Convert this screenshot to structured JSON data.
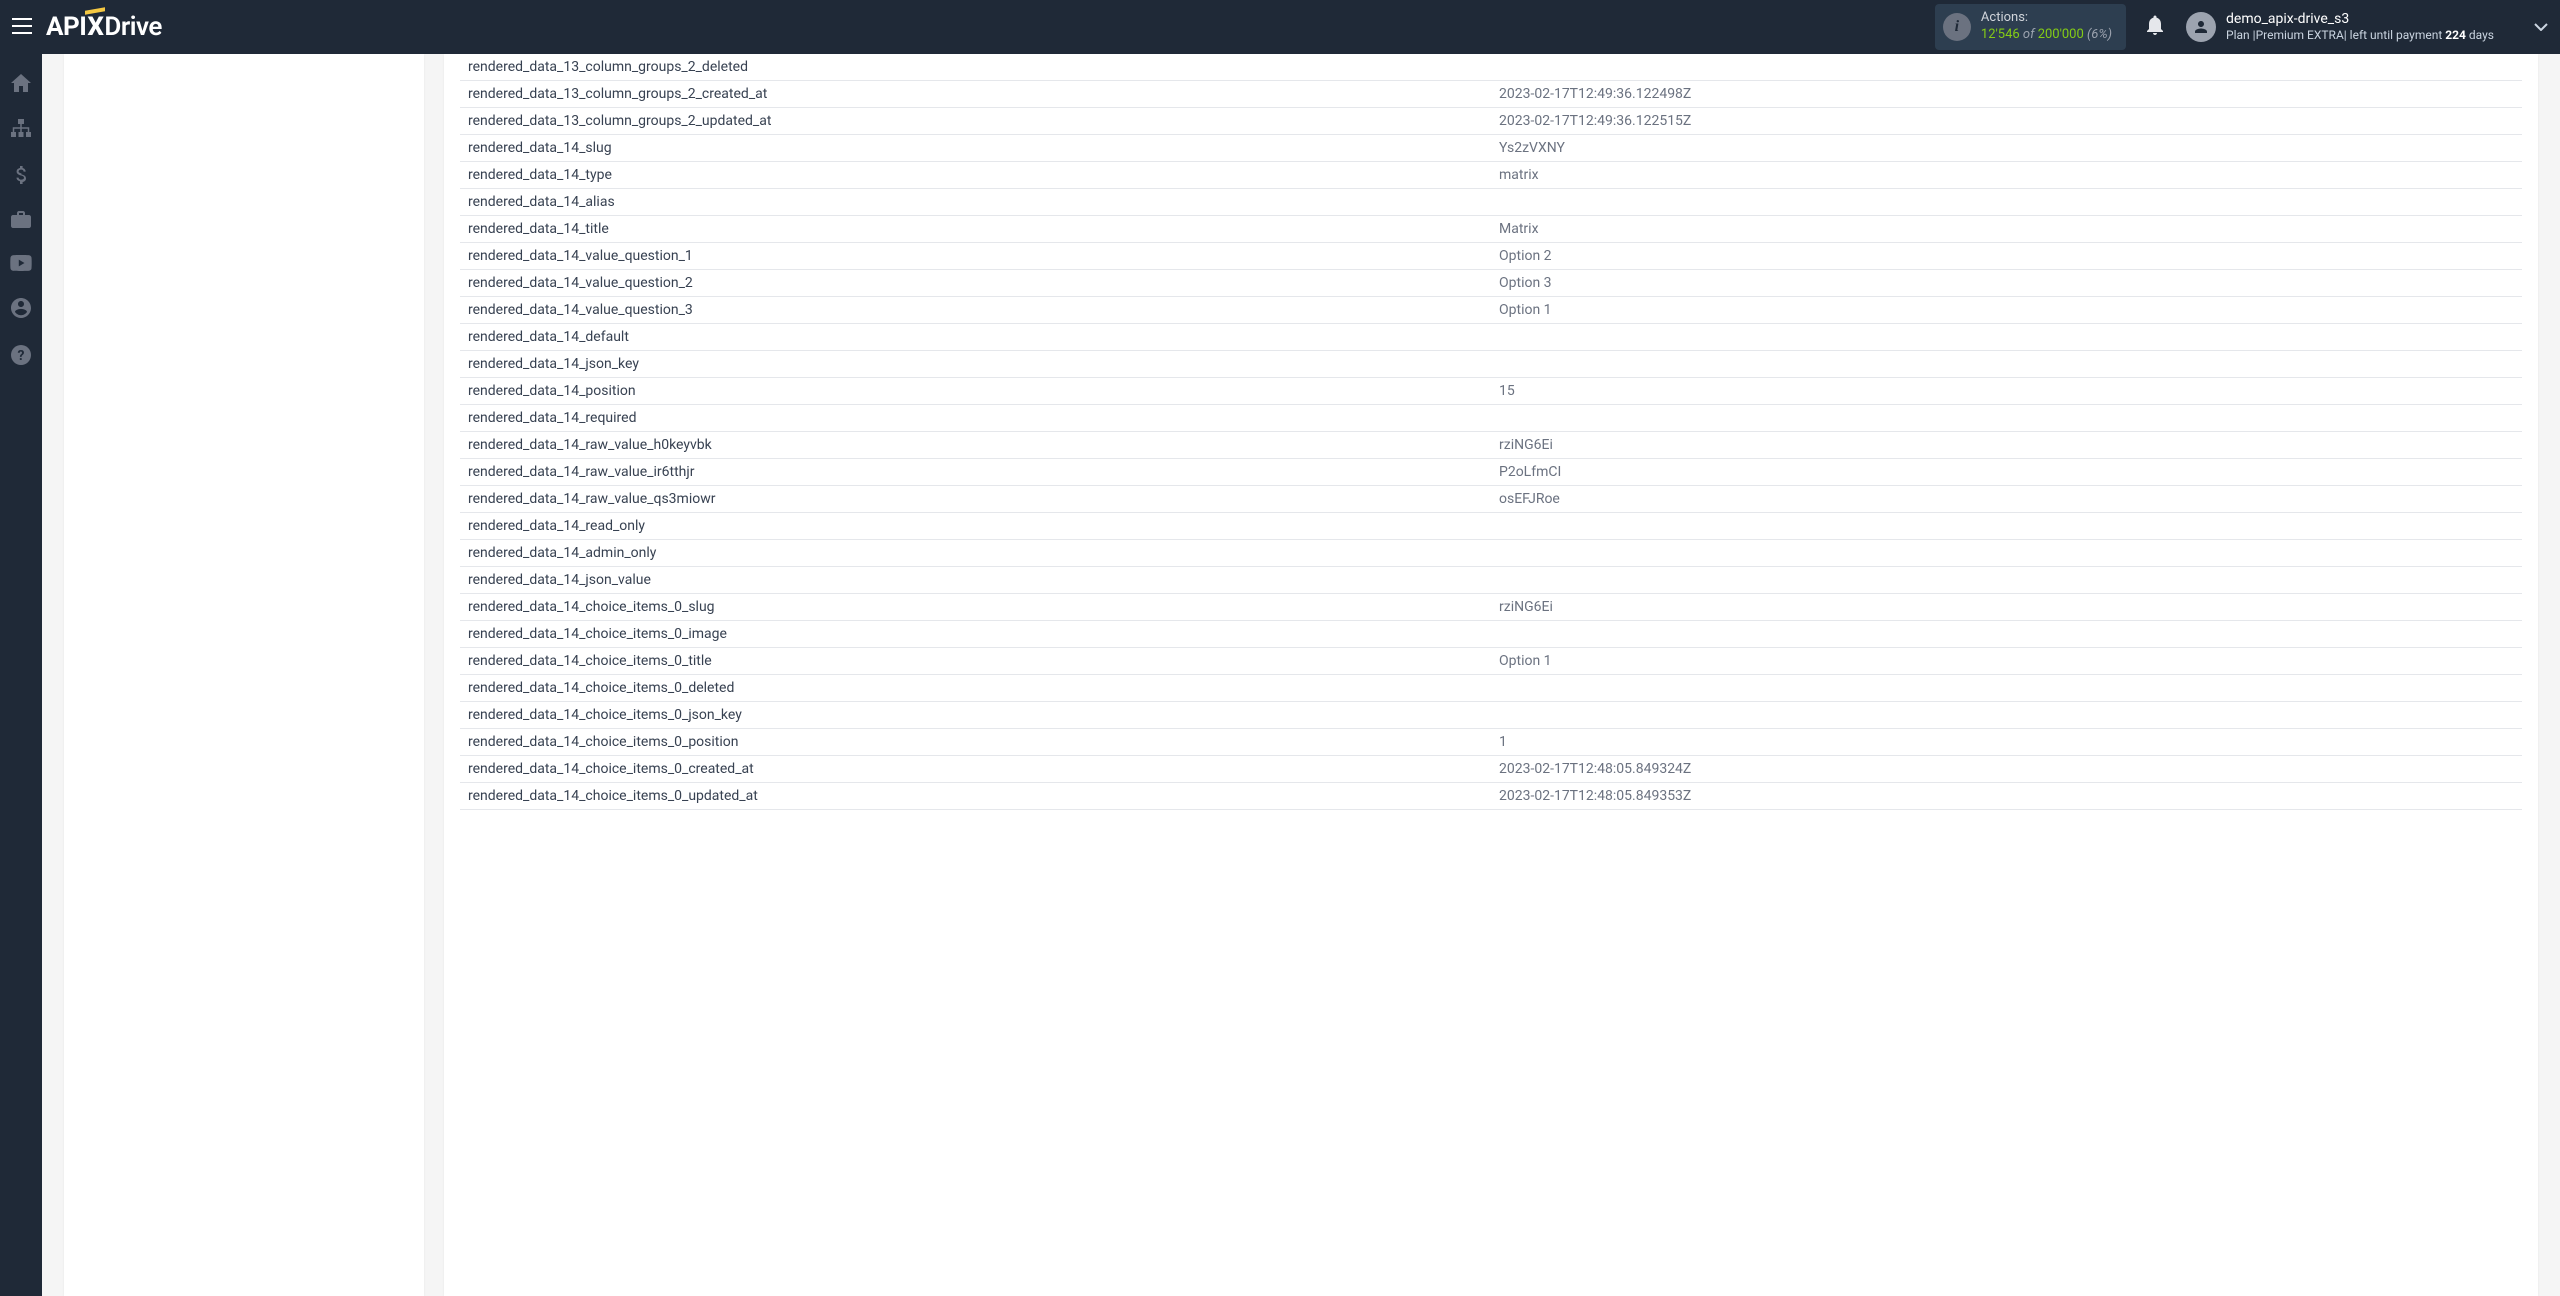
{
  "header": {
    "logo_api": "API",
    "logo_drive": "Drive",
    "actions_label": "Actions:",
    "actions_count": "12'546",
    "actions_of": " of ",
    "actions_total": "200'000",
    "actions_pct": " (6%)"
  },
  "user": {
    "name": "demo_apix-drive_s3",
    "plan_prefix": "Plan |",
    "plan_name": "Premium EXTRA",
    "plan_mid": "| left until payment ",
    "plan_days_num": "224",
    "plan_days_suffix": " days"
  },
  "rows": [
    {
      "key": "rendered_data_13_column_groups_2_deleted",
      "val": ""
    },
    {
      "key": "rendered_data_13_column_groups_2_created_at",
      "val": "2023-02-17T12:49:36.122498Z"
    },
    {
      "key": "rendered_data_13_column_groups_2_updated_at",
      "val": "2023-02-17T12:49:36.122515Z"
    },
    {
      "key": "rendered_data_14_slug",
      "val": "Ys2zVXNY"
    },
    {
      "key": "rendered_data_14_type",
      "val": "matrix"
    },
    {
      "key": "rendered_data_14_alias",
      "val": ""
    },
    {
      "key": "rendered_data_14_title",
      "val": "Matrix"
    },
    {
      "key": "rendered_data_14_value_question_1",
      "val": "Option 2"
    },
    {
      "key": "rendered_data_14_value_question_2",
      "val": "Option 3"
    },
    {
      "key": "rendered_data_14_value_question_3",
      "val": "Option 1"
    },
    {
      "key": "rendered_data_14_default",
      "val": ""
    },
    {
      "key": "rendered_data_14_json_key",
      "val": ""
    },
    {
      "key": "rendered_data_14_position",
      "val": "15"
    },
    {
      "key": "rendered_data_14_required",
      "val": ""
    },
    {
      "key": "rendered_data_14_raw_value_h0keyvbk",
      "val": "rziNG6Ei"
    },
    {
      "key": "rendered_data_14_raw_value_ir6tthjr",
      "val": "P2oLfmCI"
    },
    {
      "key": "rendered_data_14_raw_value_qs3miowr",
      "val": "osEFJRoe"
    },
    {
      "key": "rendered_data_14_read_only",
      "val": ""
    },
    {
      "key": "rendered_data_14_admin_only",
      "val": ""
    },
    {
      "key": "rendered_data_14_json_value",
      "val": ""
    },
    {
      "key": "rendered_data_14_choice_items_0_slug",
      "val": "rziNG6Ei"
    },
    {
      "key": "rendered_data_14_choice_items_0_image",
      "val": ""
    },
    {
      "key": "rendered_data_14_choice_items_0_title",
      "val": "Option 1"
    },
    {
      "key": "rendered_data_14_choice_items_0_deleted",
      "val": ""
    },
    {
      "key": "rendered_data_14_choice_items_0_json_key",
      "val": ""
    },
    {
      "key": "rendered_data_14_choice_items_0_position",
      "val": "1"
    },
    {
      "key": "rendered_data_14_choice_items_0_created_at",
      "val": "2023-02-17T12:48:05.849324Z"
    },
    {
      "key": "rendered_data_14_choice_items_0_updated_at",
      "val": "2023-02-17T12:48:05.849353Z"
    }
  ]
}
